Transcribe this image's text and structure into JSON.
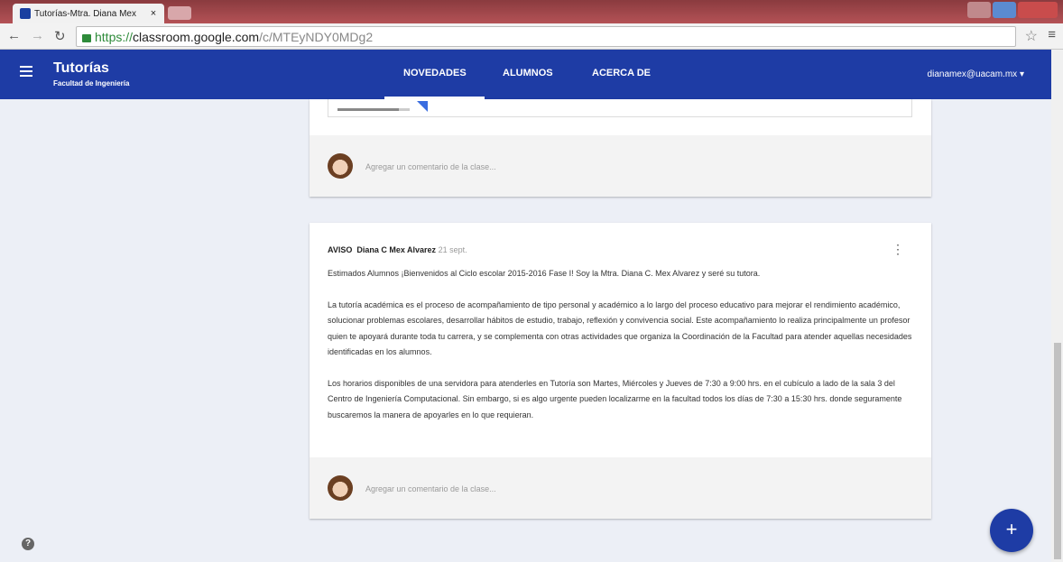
{
  "browser": {
    "tab_title": "Tutorías-Mtra. Diana Mex",
    "tab_close": "×",
    "url_https": "https://",
    "url_host": "classroom.google.com",
    "url_path": "/c/MTEyNDY0MDg2",
    "nav_icons": [
      "back-arrow-icon",
      "forward-arrow-icon",
      "reload-icon"
    ]
  },
  "header": {
    "title": "Tutorías",
    "subtitle": "Facultad de Ingeniería",
    "tabs": [
      {
        "label": "NOVEDADES",
        "active": true
      },
      {
        "label": "ALUMNOS",
        "active": false
      },
      {
        "label": "ACERCA DE",
        "active": false
      }
    ],
    "account": "dianamex@uacam.mx"
  },
  "attachment": {
    "progress": 0.85
  },
  "comment_placeholder": "Agregar un comentario de la clase...",
  "post": {
    "type_label": "AVISO",
    "author": "Diana C Mex Alvarez",
    "date": "21 sept.",
    "paragraphs": [
      "Estimados Alumnos ¡Bienvenidos al Ciclo escolar 2015-2016 Fase I! Soy la Mtra. Diana C. Mex Alvarez y seré su tutora.",
      "La tutoría académica es el proceso de acompañamiento de tipo personal y académico a lo largo del proceso educativo para mejorar el rendimiento académico, solucionar problemas escolares, desarrollar hábitos de estudio, trabajo, reflexión y convivencia social. Este acompañamiento lo realiza principalmente un profesor quien te apoyará durante toda tu carrera, y se complementa con otras actividades que organiza la Coordinación de la Facultad para atender aquellas necesidades identificadas en los alumnos.",
      "Los horarios disponibles de una servidora para atenderles en Tutoría son Martes, Miércoles y Jueves de 7:30 a 9:00 hrs. en el cubículo a lado de la sala 3 del Centro de Ingeniería Computacional. Sin embargo, si es algo urgente pueden localizarme en la facultad todos los días de 7:30 a 15:30 hrs. donde seguramente buscaremos la manera de apoyarles en lo que requieran."
    ]
  },
  "help_label": "?",
  "fab_label": "+",
  "colors": {
    "brand": "#1e3ca5",
    "page_bg": "#eceff6"
  }
}
